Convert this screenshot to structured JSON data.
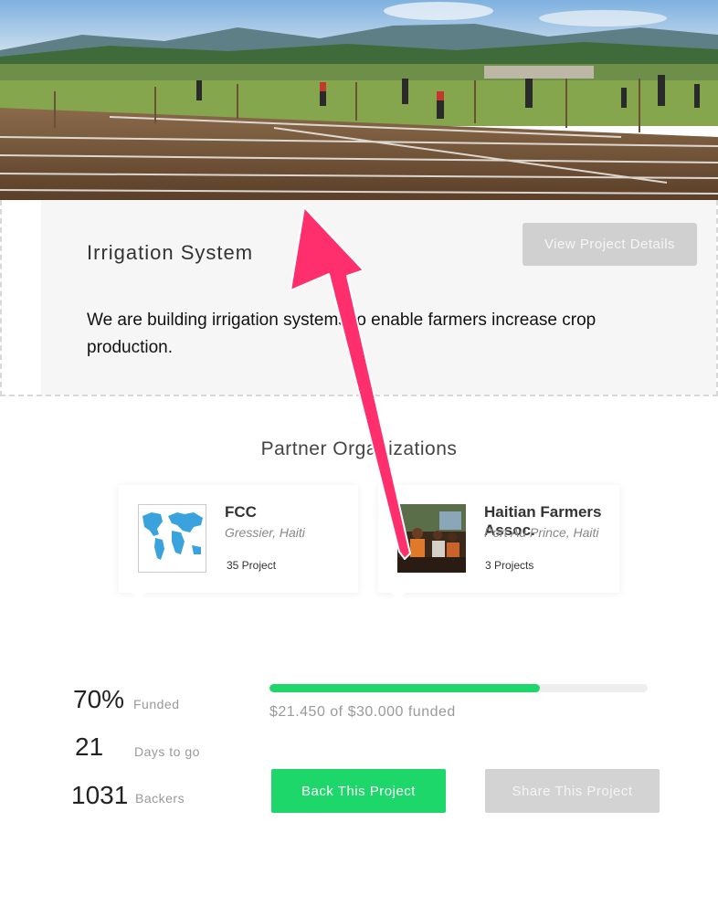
{
  "project": {
    "title": "Irrigation System",
    "description": "We are building irrigation systems to enable farmers increase crop production.",
    "details_button": "View Project Details"
  },
  "partners": {
    "heading": "Partner Organizations",
    "items": [
      {
        "name": "FCC",
        "location": "Gressier, Haiti",
        "count": "35 Project",
        "thumb": "world-map-image"
      },
      {
        "name": "Haitian Farmers Assoc.",
        "location": "Port Au Prince, Haiti",
        "count": "3 Projects",
        "thumb": "meeting-photo"
      }
    ]
  },
  "stats": {
    "funded_value": "70%",
    "funded_label": "Funded",
    "days_value": "21",
    "days_label": "Days to go",
    "backers_value": "1031",
    "backers_label": "Backers"
  },
  "funding": {
    "progress": 0.715,
    "text": "$21.450 of $30.000 funded"
  },
  "actions": {
    "back_label": "Back This Project",
    "share_label": "Share This Project"
  },
  "colors": {
    "accent_green": "#1ed76a",
    "disabled_gray": "#d3d3d3",
    "annotation_pink": "#ff2f6e"
  }
}
